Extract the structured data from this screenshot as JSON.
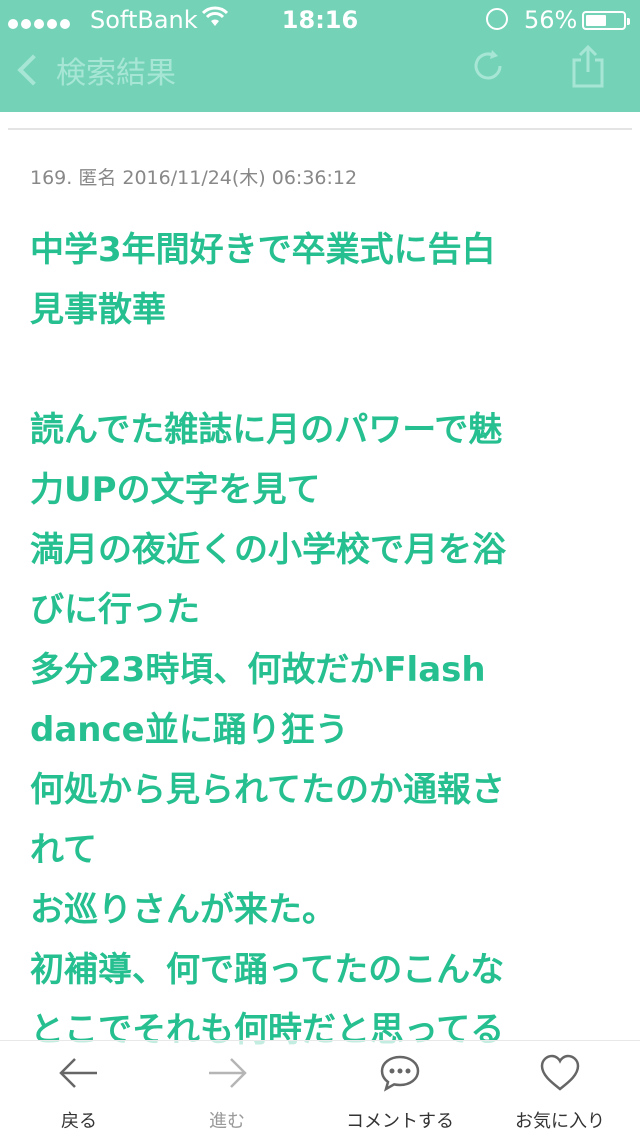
{
  "status_bar": {
    "carrier": "SoftBank",
    "time": "18:16",
    "battery": "56%",
    "battery_level": 0.56
  },
  "nav": {
    "back_label": "検索結果"
  },
  "post": {
    "meta": "169. 匿名 2016/11/24(木) 06:36:12",
    "lines": [
      "中学3年間好きで卒業式に告白",
      "見事散華",
      "",
      "読んでた雑誌に月のパワーで魅",
      "力UPの文字を見て",
      "満月の夜近くの小学校で月を浴",
      "びに行った",
      "多分23時頃、何故だかFlash",
      "dance並に踊り狂う",
      "何処から見られてたのか通報さ",
      "れて",
      "お巡りさんが来た。",
      "初補導、何で踊ってたのこんな",
      "とこでそれも何時だと思ってる"
    ]
  },
  "toolbar": {
    "back": "戻る",
    "forward": "進む",
    "comment": "コメントする",
    "favorite": "お気に入り"
  },
  "colors": {
    "header": "#74d3b7",
    "accent_text": "#26bf8f"
  }
}
